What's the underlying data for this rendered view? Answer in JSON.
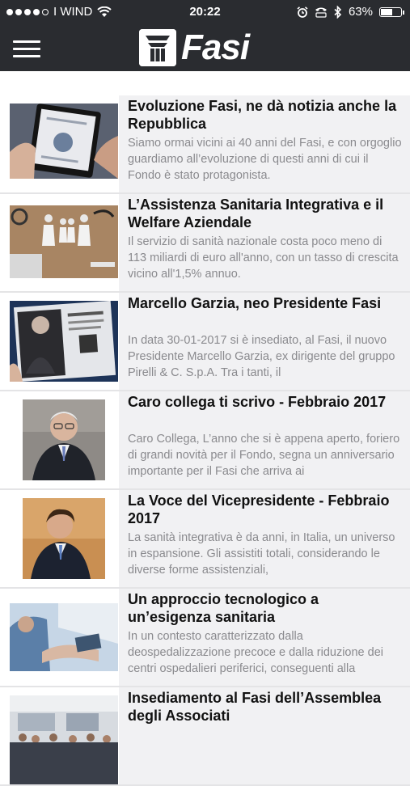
{
  "status_bar": {
    "carrier": "I WIND",
    "time": "20:22",
    "battery": "63%",
    "battery_level": 0.63,
    "signal_bars": 4,
    "icons": [
      "wifi-icon",
      "alarm-icon",
      "tty-icon",
      "bluetooth-icon",
      "battery-icon"
    ]
  },
  "header": {
    "menu_icon": "hamburger-menu-icon",
    "logo_text": "Fasi"
  },
  "colors": {
    "header_bg": "#2a2c30",
    "item_text_bg": "#f1f1f3",
    "excerpt_color": "#8a8a8e"
  },
  "articles": [
    {
      "title": "Evoluzione Fasi, ne dà notizia anche la Repubblica",
      "excerpt": "Siamo ormai vicini ai 40 anni del Fasi, e con orgoglio guardiamo all’evoluzione di questi anni di cui il Fondo è stato protagonista."
    },
    {
      "title": "L’Assistenza Sanitaria Integrativa e il Welfare Aziendale",
      "excerpt": "Il servizio di sanità nazionale costa poco meno di 113 miliardi di euro all'anno, con un tasso di crescita vicino all'1,5% annuo."
    },
    {
      "title": "Marcello Garzia, neo Presidente Fasi",
      "excerpt": "In data 30-01-2017 si è insediato, al Fasi, il nuovo Presidente Marcello Garzia, ex dirigente del gruppo Pirelli & C. S.p.A. Tra i tanti, il"
    },
    {
      "title": "Caro collega ti scrivo - Febbraio 2017",
      "excerpt": "Caro Collega, L’anno che si è appena aperto, foriero di grandi novità per il Fondo, segna un anniversario importante per il Fasi che arriva ai"
    },
    {
      "title": "La Voce del Vicepresidente - Febbraio 2017",
      "excerpt": "La sanità integrativa è da anni, in Italia, un universo in espansione. Gli assistiti totali, considerando le diverse forme assistenziali,"
    },
    {
      "title": "Un approccio tecnologico a un’esigenza sanitaria",
      "excerpt": "In un contesto caratterizzato dalla deospedalizzazione precoce e dalla riduzione dei centri ospedalieri periferici, conseguenti alla"
    },
    {
      "title": "Insediamento al Fasi dell’Assemblea degli Associati",
      "excerpt": ""
    }
  ]
}
